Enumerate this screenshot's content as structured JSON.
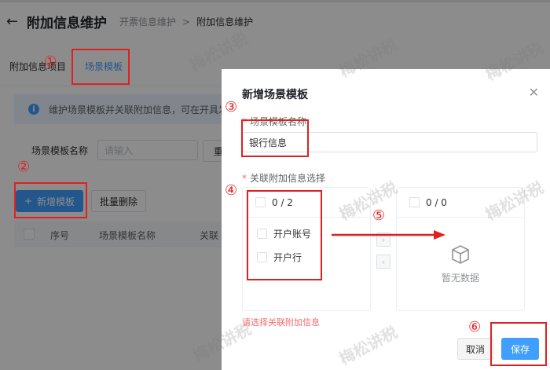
{
  "header": {
    "title": "附加信息维护",
    "breadcrumb": [
      "开票信息维护",
      "附加信息维护"
    ],
    "breadcrumb_sep": ">"
  },
  "tabs": [
    {
      "label": "附加信息项目"
    },
    {
      "label": "场景模板",
      "active": true
    }
  ],
  "info_text": "维护场景模板并关联附加信息，可在开具发票",
  "filter": {
    "label": "场景模板名称",
    "placeholder": "请输入",
    "reset_label": "重"
  },
  "actions": {
    "add_label": "新增模板",
    "batch_delete_label": "批量删除"
  },
  "table": {
    "columns": [
      "序号",
      "场景模板名称",
      "关联"
    ]
  },
  "drawer": {
    "title": "新增场景模板",
    "name_label": "场景模板名称",
    "name_value": "银行信息",
    "assoc_label": "关联附加信息选择",
    "left_panel": {
      "count": "0 / 2",
      "items": [
        "开户账号",
        "开户行"
      ]
    },
    "right_panel": {
      "count": "0 / 0",
      "empty_text": "暂无数据"
    },
    "error_text": "请选择关联附加信息",
    "cancel_label": "取消",
    "save_label": "保存"
  },
  "annotations": [
    "①",
    "②",
    "③",
    "④",
    "⑤",
    "⑥"
  ],
  "watermark": "梅松讲税",
  "colors": {
    "primary": "#409eff",
    "annotation_red": "#e02020",
    "error": "#f56c6c"
  }
}
